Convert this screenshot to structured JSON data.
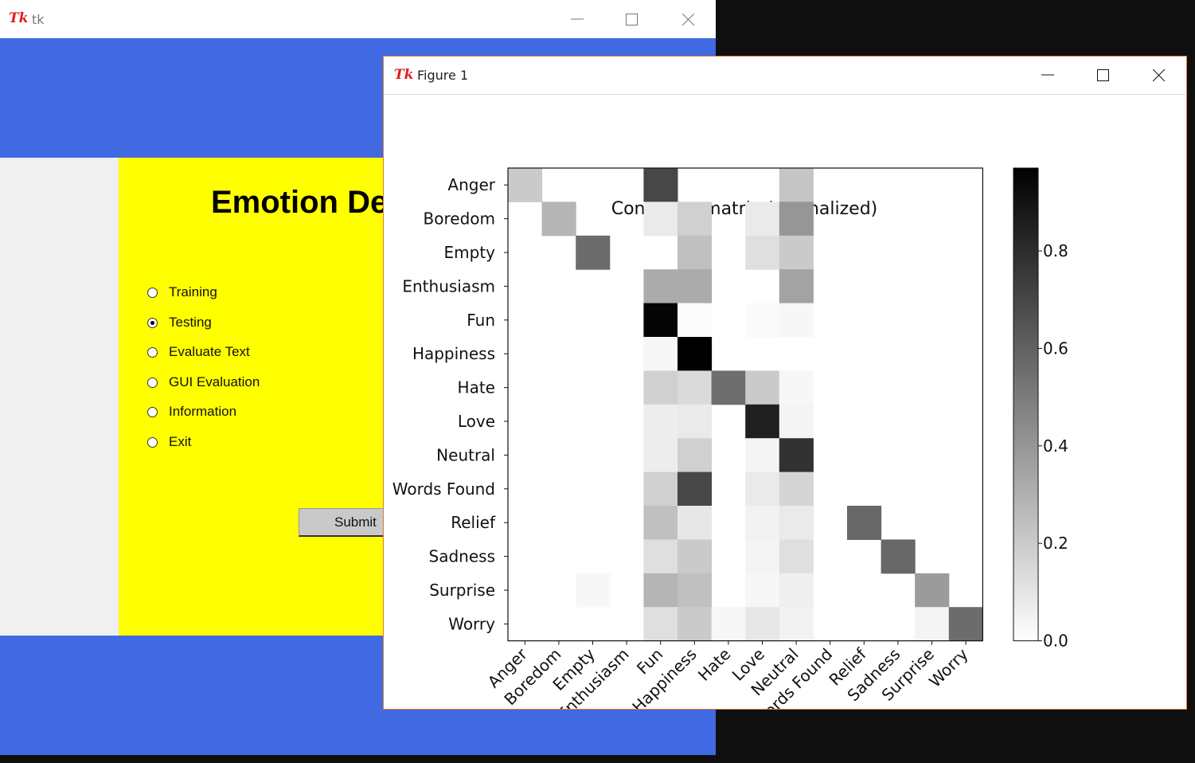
{
  "main_window": {
    "title": "tk",
    "logo": "Tk",
    "heading": "Emotion De",
    "options": [
      {
        "label": "Training",
        "selected": false
      },
      {
        "label": "Testing",
        "selected": true
      },
      {
        "label": "Evaluate Text",
        "selected": false
      },
      {
        "label": "GUI Evaluation",
        "selected": false
      },
      {
        "label": "Information",
        "selected": false
      },
      {
        "label": "Exit",
        "selected": false
      }
    ],
    "submit_label": "Submit",
    "colors": {
      "background": "#4169e1",
      "panel": "#ffff00",
      "side": "#f0f0f0"
    }
  },
  "figure_window": {
    "title": "Figure 1",
    "logo": "Tk"
  },
  "chart_data": {
    "type": "heatmap",
    "title": "Confusion matrix (normalized)",
    "row_labels": [
      "Anger",
      "Boredom",
      "Empty",
      "Enthusiasm",
      "Fun",
      "Happiness",
      "Hate",
      "Love",
      "Neutral",
      "Words Found",
      "Relief",
      "Sadness",
      "Surprise",
      "Worry"
    ],
    "col_labels": [
      "Anger",
      "Boredom",
      "Empty",
      "Enthusiasm",
      "Fun",
      "Happiness",
      "Hate",
      "Love",
      "Neutral",
      "Words Found",
      "Relief",
      "Sadness",
      "Surprise",
      "Worry"
    ],
    "values": [
      [
        0.2,
        0,
        0,
        0,
        0.7,
        0,
        0,
        0,
        0.22,
        0,
        0,
        0,
        0,
        0
      ],
      [
        0,
        0.28,
        0,
        0,
        0.08,
        0.18,
        0,
        0.08,
        0.4,
        0,
        0,
        0,
        0,
        0
      ],
      [
        0,
        0,
        0.56,
        0,
        0,
        0.24,
        0,
        0.12,
        0.2,
        0,
        0,
        0,
        0,
        0
      ],
      [
        0,
        0,
        0,
        0,
        0.32,
        0.32,
        0,
        0,
        0.35,
        0,
        0,
        0,
        0,
        0
      ],
      [
        0,
        0,
        0,
        0,
        0.95,
        0.01,
        0,
        0.02,
        0.03,
        0,
        0,
        0,
        0,
        0
      ],
      [
        0,
        0,
        0,
        0,
        0.03,
        0.97,
        0,
        0,
        0,
        0,
        0,
        0,
        0,
        0
      ],
      [
        0,
        0,
        0,
        0,
        0.18,
        0.14,
        0.55,
        0.2,
        0.03,
        0,
        0,
        0,
        0,
        0
      ],
      [
        0,
        0,
        0,
        0,
        0.07,
        0.08,
        0,
        0.85,
        0.04,
        0,
        0,
        0,
        0,
        0
      ],
      [
        0,
        0,
        0,
        0,
        0.07,
        0.18,
        0,
        0.04,
        0.78,
        0,
        0,
        0,
        0,
        0
      ],
      [
        0,
        0,
        0,
        0,
        0.18,
        0.7,
        0,
        0.08,
        0.16,
        0,
        0,
        0,
        0,
        0
      ],
      [
        0,
        0,
        0,
        0,
        0.24,
        0.09,
        0,
        0.05,
        0.08,
        0,
        0.58,
        0,
        0,
        0
      ],
      [
        0,
        0,
        0,
        0,
        0.12,
        0.2,
        0,
        0.04,
        0.12,
        0,
        0,
        0.58,
        0,
        0
      ],
      [
        0,
        0,
        0.03,
        0,
        0.28,
        0.24,
        0,
        0.03,
        0.06,
        0,
        0,
        0,
        0.38,
        0
      ],
      [
        0,
        0,
        0,
        0,
        0.12,
        0.2,
        0.03,
        0.09,
        0.05,
        0,
        0,
        0,
        0.04,
        0.56
      ]
    ],
    "colorbar_ticks": [
      "0.0",
      "0.2",
      "0.4",
      "0.6",
      "0.8"
    ],
    "colorbar_range": [
      0,
      0.97
    ],
    "colormap": "Greys"
  }
}
